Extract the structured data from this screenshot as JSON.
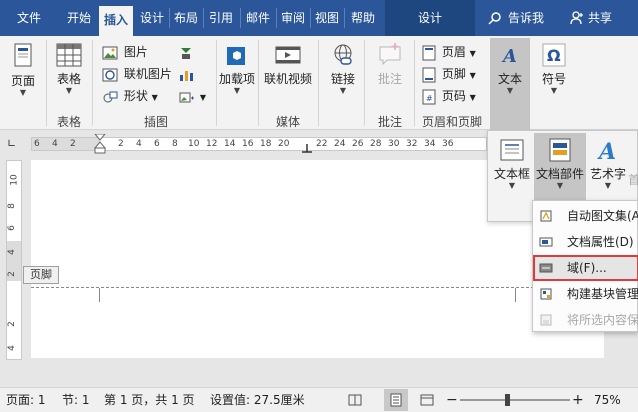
{
  "tabs": [
    "文件",
    "开始",
    "插入",
    "设计",
    "布局",
    "引用",
    "邮件",
    "审阅",
    "视图",
    "帮助"
  ],
  "active_tab": "插入",
  "context_tab": "设计",
  "tell_me": "告诉我",
  "share": "共享",
  "ribbon": {
    "page": "页面",
    "table": "表格",
    "table_group": "表格",
    "picture": "图片",
    "online_picture": "联机图片",
    "shapes": "形状",
    "illustrations_group": "插图",
    "addins": "加载项",
    "online_video": "联机视频",
    "media_group": "媒体",
    "link": "链接",
    "comment": "批注",
    "comment_group": "批注",
    "header": "页眉",
    "footer": "页脚",
    "page_number": "页码",
    "hf_group": "页眉和页脚",
    "text": "文本",
    "symbol": "符号"
  },
  "ruler_numbers": [
    "6",
    "4",
    "2",
    "2",
    "4",
    "6",
    "8",
    "10",
    "12",
    "14",
    "16",
    "18",
    "20",
    "22",
    "24",
    "26",
    "28",
    "30",
    "32",
    "34",
    "36"
  ],
  "vruler_numbers": [
    "10",
    "8",
    "6",
    "4",
    "2",
    "2",
    "4"
  ],
  "footer_tag": "页脚",
  "text_panel": {
    "textbox": "文本框",
    "quick_parts": "文档部件",
    "wordart": "艺术字",
    "more": "首"
  },
  "quick_parts_menu": [
    {
      "label": "自动图文集(A)",
      "icon": "autotext-icon",
      "disabled": false
    },
    {
      "label": "文档属性(D)",
      "icon": "doc-property-icon",
      "disabled": false
    },
    {
      "label": "域(F)...",
      "icon": "field-icon",
      "disabled": false,
      "highlight": true
    },
    {
      "label": "构建基块管理器(B)...",
      "icon": "building-blocks-icon",
      "disabled": false
    },
    {
      "label": "将所选内容保存到文档部件库(S)...",
      "icon": "save-selection-icon",
      "disabled": true
    }
  ],
  "status": {
    "page": "页面: 1",
    "section": "节: 1",
    "pages": "第 1 页，共 1 页",
    "position": "设置值: 27.5厘米",
    "zoom": "75%"
  },
  "colors": {
    "tab_blue": "#2b579a",
    "highlight_red": "#e03a3a"
  }
}
